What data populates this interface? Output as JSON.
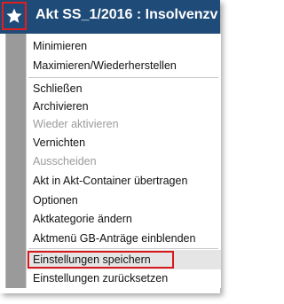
{
  "window": {
    "title": "Akt SS_1/2016 : Insolvenzv",
    "icon": "star-icon",
    "colors": {
      "titlebar": "#1f4b78",
      "highlight_border": "#d7181c",
      "menu_gutter": "#9a9a9a"
    }
  },
  "menu": {
    "items": [
      {
        "label": "Minimieren",
        "enabled": true
      },
      {
        "label": "Maximieren/Wiederherstellen",
        "enabled": true
      },
      {
        "label": "Schließen",
        "enabled": true
      },
      {
        "label": "Archivieren",
        "enabled": true
      },
      {
        "label": "Wieder aktivieren",
        "enabled": false
      },
      {
        "label": "Vernichten",
        "enabled": true
      },
      {
        "label": "Ausscheiden",
        "enabled": false
      },
      {
        "label": "Akt in Akt-Container übertragen",
        "enabled": true
      },
      {
        "label": "Optionen",
        "enabled": true
      },
      {
        "label": "Aktkategorie ändern",
        "enabled": true
      },
      {
        "label": "Aktmenü GB-Anträge einblenden",
        "enabled": true
      },
      {
        "label": "Einstellungen speichern",
        "enabled": true,
        "highlighted": true
      },
      {
        "label": "Einstellungen zurücksetzen",
        "enabled": true
      }
    ]
  }
}
